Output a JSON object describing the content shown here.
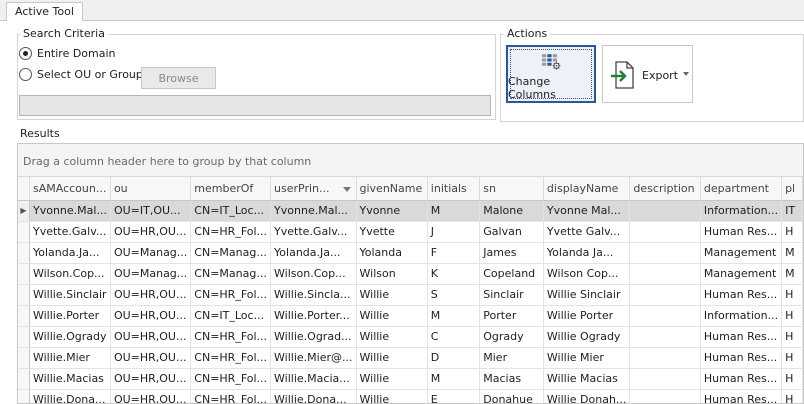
{
  "tab": {
    "label": "Active Tool"
  },
  "search": {
    "title": "Search Criteria",
    "option_domain": "Entire Domain",
    "option_ou": "Select OU or Group",
    "browse_label": "Browse",
    "path_value": ""
  },
  "actions": {
    "title": "Actions",
    "change_columns": "Change Columns",
    "export": "Export"
  },
  "results": {
    "title": "Results",
    "group_hint": "Drag a column header here to group by that column",
    "columns": [
      "sAMAccoun...",
      "ou",
      "memberOf",
      "userPrin...",
      "givenName",
      "initials",
      "sn",
      "displayName",
      "description",
      "department",
      "pl"
    ],
    "rows": [
      [
        "Yvonne.Mal...",
        "OU=IT,OU...",
        "CN=IT_Loc...",
        "Yvonne.Mal...",
        "Yvonne",
        "M",
        "Malone",
        "Yvonne Mal...",
        "",
        "Information...",
        "IT"
      ],
      [
        "Yvette.Galv...",
        "OU=HR,OU...",
        "CN=HR_Fol...",
        "Yvette.Galv...",
        "Yvette",
        "J",
        "Galvan",
        "Yvette Galv...",
        "",
        "Human Res...",
        "H"
      ],
      [
        "Yolanda.Ja...",
        "OU=Manag...",
        "CN=Manag...",
        "Yolanda.Ja...",
        "Yolanda",
        "F",
        "James",
        "Yolanda Ja...",
        "",
        "Management",
        "M"
      ],
      [
        "Wilson.Cop...",
        "OU=Manag...",
        "CN=Manag...",
        "Wilson.Cop...",
        "Wilson",
        "K",
        "Copeland",
        "Wilson Cop...",
        "",
        "Management",
        "M"
      ],
      [
        "Willie.Sinclair",
        "OU=HR,OU...",
        "CN=HR_Fol...",
        "Willie.Sincla...",
        "Willie",
        "S",
        "Sinclair",
        "Willie Sinclair",
        "",
        "Human Res...",
        "H"
      ],
      [
        "Willie.Porter",
        "OU=HR,OU...",
        "CN=IT_Loc...",
        "Willie.Porter...",
        "Willie",
        "M",
        "Porter",
        "Willie Porter",
        "",
        "Information...",
        "H"
      ],
      [
        "Willie.Ogrady",
        "OU=HR,OU...",
        "CN=HR_Fol...",
        "Willie.Ograd...",
        "Willie",
        "C",
        "Ogrady",
        "Willie Ogrady",
        "",
        "Human Res...",
        "H"
      ],
      [
        "Willie.Mier",
        "OU=HR,OU...",
        "CN=HR_Fol...",
        "Willie.Mier@...",
        "Willie",
        "D",
        "Mier",
        "Willie Mier",
        "",
        "Human Res...",
        "H"
      ],
      [
        "Willie.Macias",
        "OU=HR,OU...",
        "CN=HR_Fol...",
        "Willie.Macia...",
        "Willie",
        "M",
        "Macias",
        "Willie Macias",
        "",
        "Human Res...",
        "H"
      ],
      [
        "Willie.Dona...",
        "OU=HR,OU...",
        "CN=HR_Fol...",
        "Willie.Dona...",
        "Willie",
        "E",
        "Donahue",
        "Willie Donah...",
        "",
        "Human Res...",
        "H"
      ]
    ]
  },
  "icons": {
    "change_columns": "columns-gear-icon",
    "export": "export-document-icon",
    "row_indicator": "current-row-icon",
    "filter": "filter-dropdown-icon"
  },
  "colors": {
    "accent": "#2b579a",
    "export_arrow": "#1e7e34",
    "selected_row": "#d9d9d9"
  }
}
